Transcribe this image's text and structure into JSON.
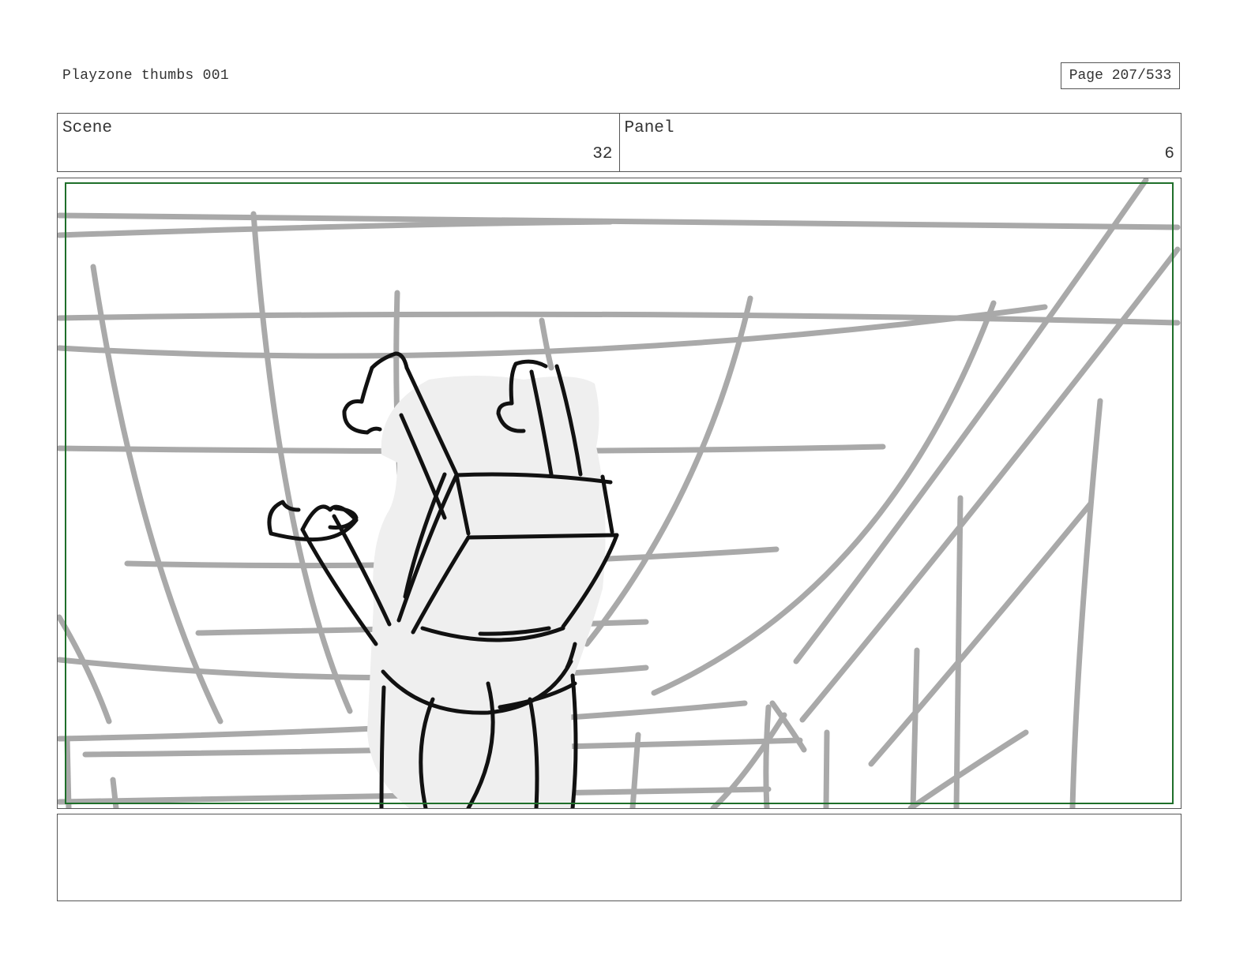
{
  "header": {
    "title": "Playzone thumbs 001",
    "page_indicator": "Page 207/533"
  },
  "info": {
    "scene_label": "Scene",
    "scene_number": "32",
    "panel_label": "Panel",
    "panel_number": "6"
  },
  "notes": {
    "text": ""
  },
  "colors": {
    "safe_area_border": "#1f6f2a",
    "background_lines": "#a9a9a9",
    "character_fill": "#efefef",
    "ink": "#111111"
  }
}
